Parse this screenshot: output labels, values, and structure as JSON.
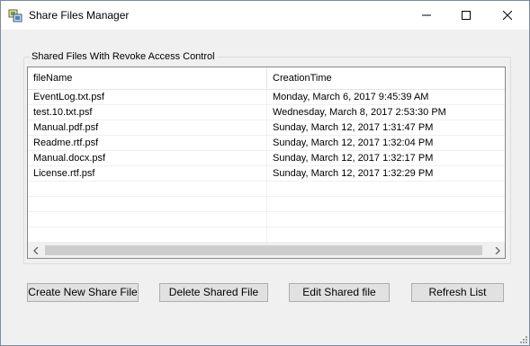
{
  "window": {
    "title": "Share Files Manager",
    "icons": {
      "app": "share-files-app-icon",
      "minimize": "minimize-icon",
      "maximize": "maximize-icon",
      "close": "close-icon"
    }
  },
  "group": {
    "label": "Shared Files  With Revoke Access Control"
  },
  "listview": {
    "columns": [
      "fileName",
      "CreationTime"
    ],
    "rows": [
      {
        "fileName": "EventLog.txt.psf",
        "creationTime": "Monday, March 6, 2017 9:45:39 AM"
      },
      {
        "fileName": "test.10.txt.psf",
        "creationTime": "Wednesday, March 8, 2017 2:53:30 PM"
      },
      {
        "fileName": "Manual.pdf.psf",
        "creationTime": "Sunday, March 12, 2017 1:31:47 PM"
      },
      {
        "fileName": "Readme.rtf.psf",
        "creationTime": "Sunday, March 12, 2017 1:32:04 PM"
      },
      {
        "fileName": "Manual.docx.psf",
        "creationTime": "Sunday, March 12, 2017 1:32:17 PM"
      },
      {
        "fileName": "License.rtf.psf",
        "creationTime": "Sunday, March 12, 2017 1:32:29 PM"
      }
    ],
    "scrollbar": {
      "left_icon": "chevron-left-icon",
      "right_icon": "chevron-right-icon"
    }
  },
  "buttons": {
    "create": "Create New Share File",
    "delete": "Delete Shared File",
    "edit": "Edit Shared file",
    "refresh": "Refresh List"
  }
}
